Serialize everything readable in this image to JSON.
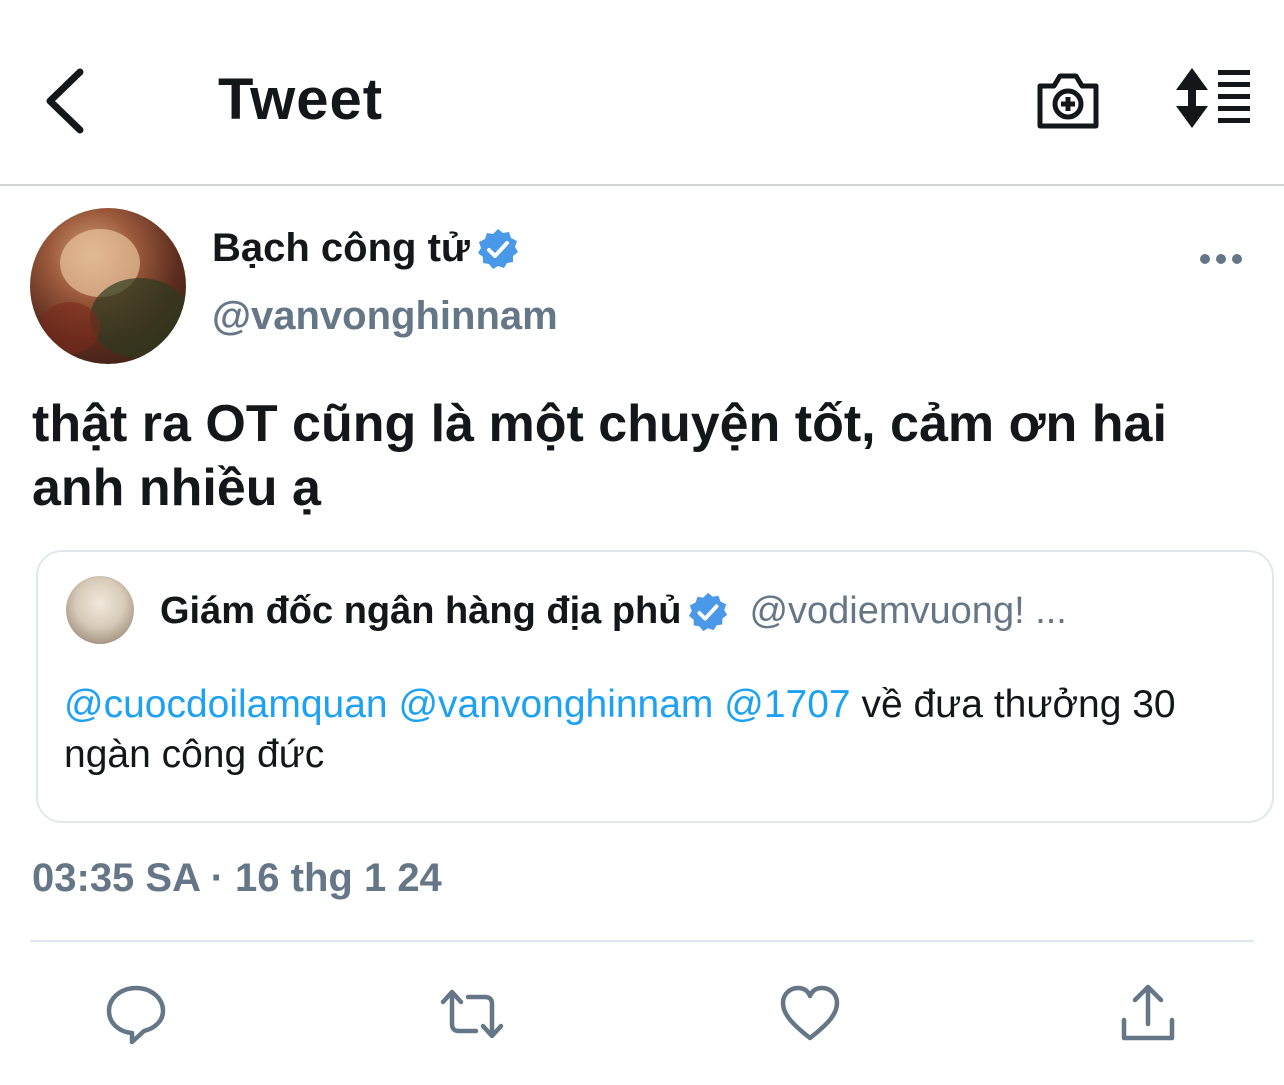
{
  "header": {
    "title": "Tweet"
  },
  "tweet": {
    "author_name": "Bạch công tử",
    "author_handle": "@vanvonghinnam",
    "text": "thật ra OT cũng là một chuyện tốt, cảm ơn hai anh nhiều ạ",
    "timestamp": "03:35 SA · 16 thg 1 24"
  },
  "quoted": {
    "author_name": "Giám đốc ngân hàng địa phủ",
    "author_handle": "@vodiemvuong! ...",
    "mentions": [
      "@cuocdoilamquan",
      "@vanvonghinnam",
      "@1707"
    ],
    "text_after_mentions": "về đưa thưởng 30 ngàn công đức"
  },
  "icons": {
    "back": "chevron-left-icon",
    "camera": "camera-plus-icon",
    "sort": "sort-list-icon",
    "more": "more-horizontal-icon",
    "verified": "verified-badge-icon",
    "reply": "reply-icon",
    "retweet": "retweet-icon",
    "like": "heart-icon",
    "share": "share-icon"
  },
  "colors": {
    "accent": "#1da1f2",
    "secondary_text": "#657786",
    "verified": "#4a99e9"
  }
}
